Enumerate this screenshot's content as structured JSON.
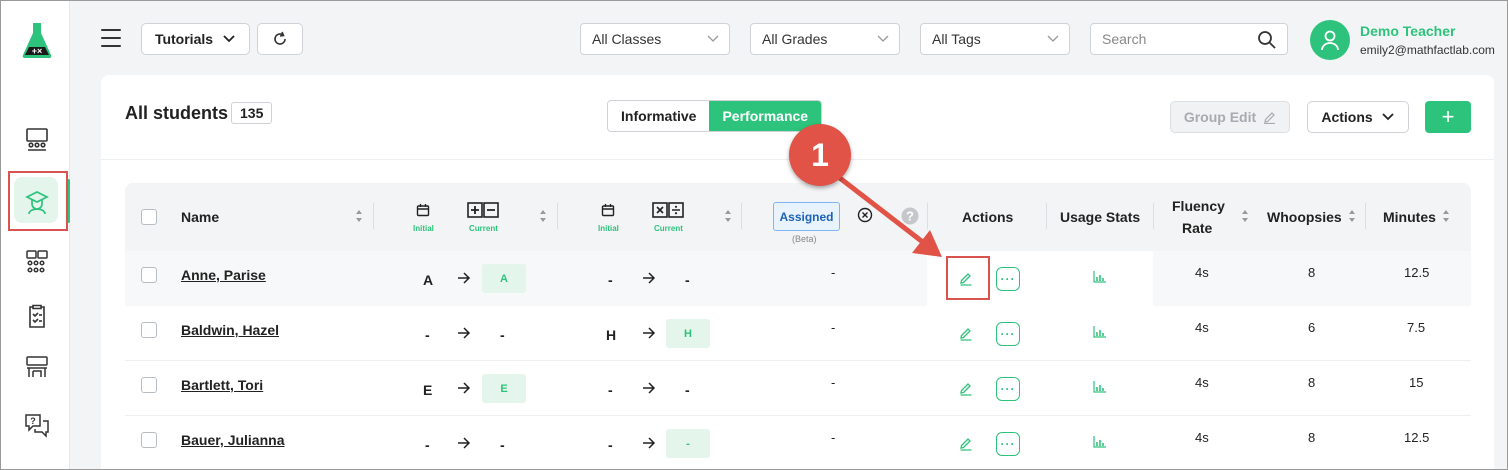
{
  "topbar": {
    "tutorials_label": "Tutorials",
    "filters": [
      {
        "label": "All Classes"
      },
      {
        "label": "All Grades"
      },
      {
        "label": "All Tags"
      }
    ],
    "search_placeholder": "Search",
    "user": {
      "name": "Demo Teacher",
      "email": "emily2@mathfactlab.com"
    }
  },
  "page": {
    "title": "All students",
    "count": "135",
    "toggle": {
      "informative": "Informative",
      "performance": "Performance",
      "active": "performance"
    },
    "group_edit_label": "Group Edit",
    "actions_label": "Actions",
    "add_label": "+"
  },
  "table": {
    "headers": {
      "name": "Name",
      "initial": "Initial",
      "current": "Current",
      "assigned": "Assigned",
      "beta": "(Beta)",
      "actions": "Actions",
      "usage_stats": "Usage Stats",
      "fluency_line1": "Fluency",
      "fluency_line2": "Rate",
      "whoopsies": "Whoopsies",
      "minutes": "Minutes"
    },
    "rows": [
      {
        "name": "Anne, Parise",
        "add_initial": "A",
        "add_current": "A",
        "mul_initial": "-",
        "mul_current": "-",
        "assigned": "-",
        "fluency": "4s",
        "whoopsies": "8",
        "minutes": "12.5"
      },
      {
        "name": "Baldwin, Hazel",
        "add_initial": "-",
        "add_current": "-",
        "mul_initial": "H",
        "mul_current": "H",
        "assigned": "-",
        "fluency": "4s",
        "whoopsies": "6",
        "minutes": "7.5"
      },
      {
        "name": "Bartlett, Tori",
        "add_initial": "E",
        "add_current": "E",
        "mul_initial": "-",
        "mul_current": "-",
        "assigned": "-",
        "fluency": "4s",
        "whoopsies": "8",
        "minutes": "15"
      },
      {
        "name": "Bauer, Julianna",
        "add_initial": "-",
        "add_current": "-",
        "mul_initial": "-",
        "mul_current": "-",
        "assigned": "-",
        "fluency": "4s",
        "whoopsies": "8",
        "minutes": "12.5"
      }
    ]
  },
  "callout": {
    "number": "1"
  },
  "colors": {
    "brand_green": "#2ec37c",
    "highlight_red": "#d9534f",
    "callout_red": "#e05346"
  }
}
